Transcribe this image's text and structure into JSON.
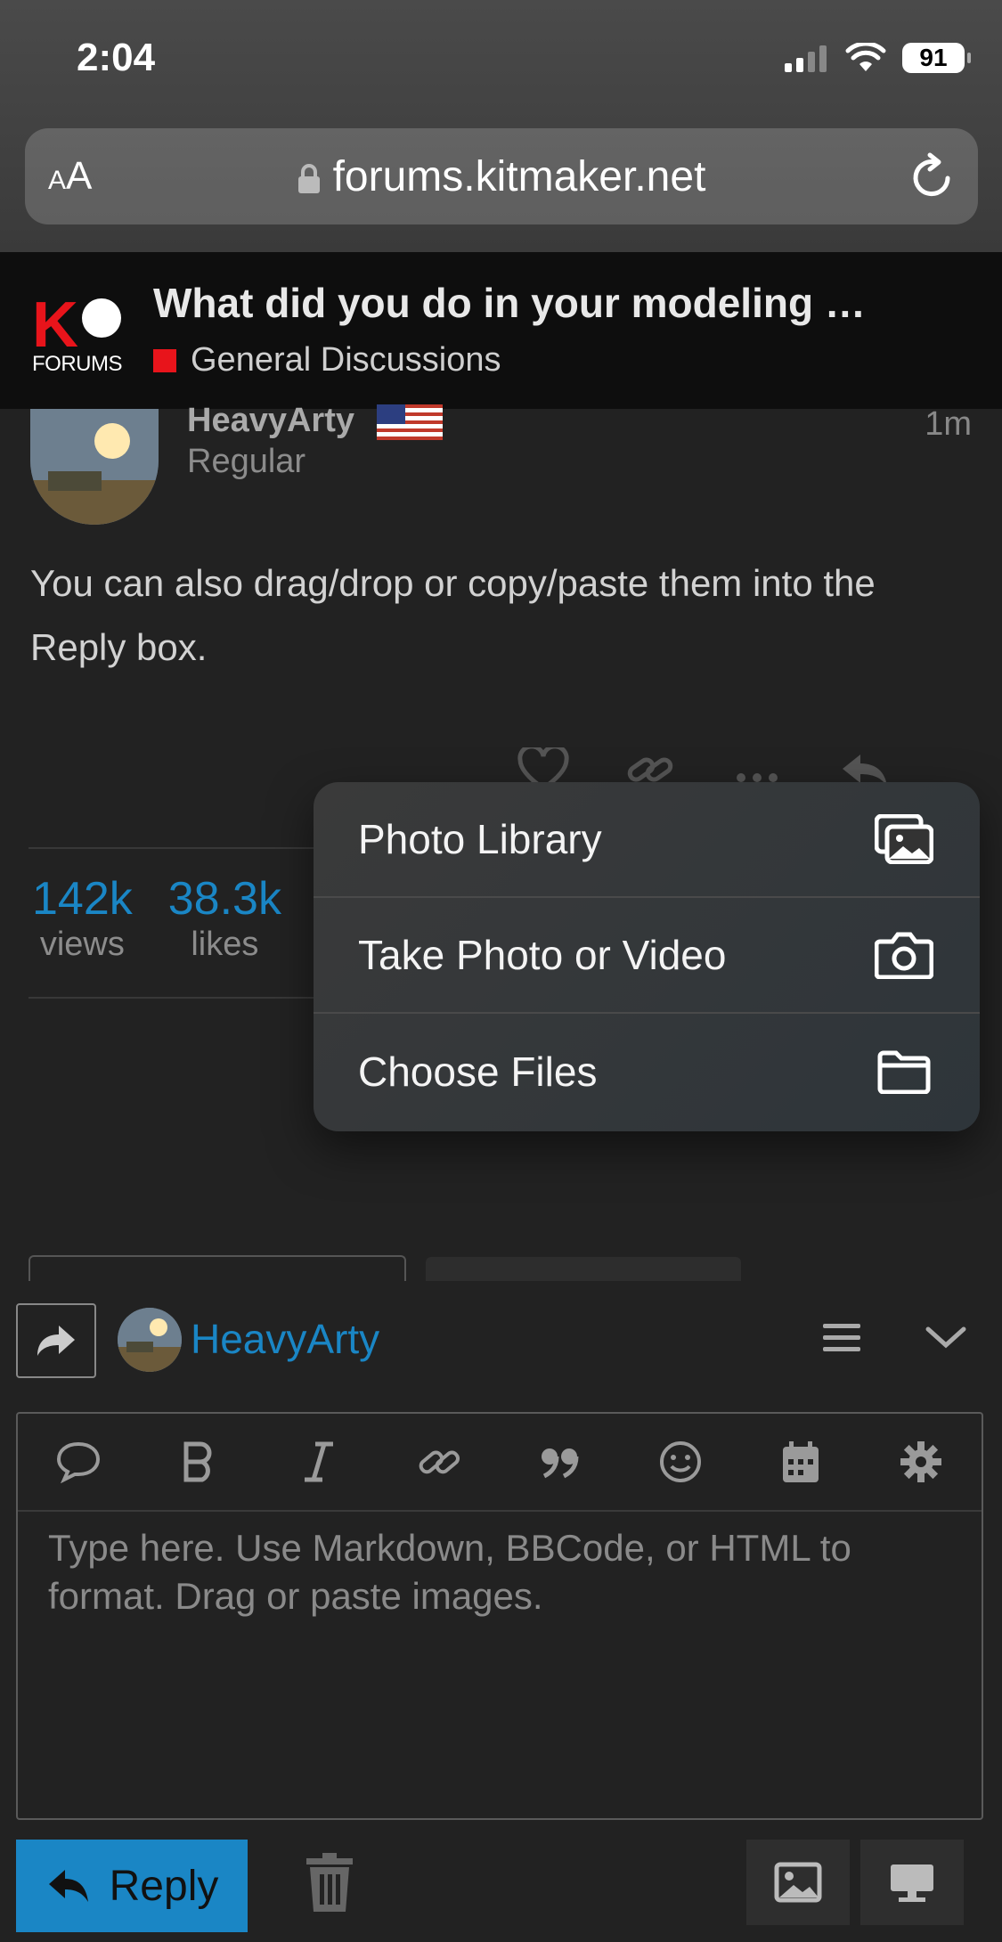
{
  "status_bar": {
    "time": "2:04",
    "battery": "91"
  },
  "browser": {
    "text_size_label": "AA",
    "url": "forums.kitmaker.net"
  },
  "forum_header": {
    "logo_text": "FORUMS",
    "logo_letter": "K",
    "topic_title": "What did you do in your modeling …",
    "category": "General Discussions",
    "category_color": "#e8141b"
  },
  "post": {
    "author": "HeavyArty",
    "author_title": "Regular",
    "time": "1m",
    "body": "You can also drag/drop or copy/paste them into the Reply box.",
    "stats": [
      {
        "value": "142k",
        "label": "views"
      },
      {
        "value": "38.3k",
        "label": "likes"
      }
    ]
  },
  "menu": {
    "items": [
      {
        "label": "Photo Library",
        "icon": "photo-library-icon"
      },
      {
        "label": "Take Photo or Video",
        "icon": "camera-icon"
      },
      {
        "label": "Choose Files",
        "icon": "folder-icon"
      }
    ]
  },
  "composer": {
    "reply_to_user": "HeavyArty",
    "placeholder": "Type here. Use Markdown, BBCode, or HTML to format. Drag or paste images.",
    "reply_button": "Reply"
  },
  "colors": {
    "accent": "#1a86c5",
    "background": "#222222"
  }
}
